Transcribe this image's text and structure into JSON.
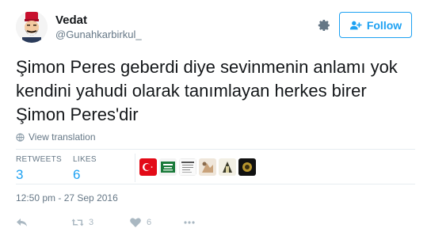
{
  "user": {
    "display_name": "Vedat",
    "handle": "@Gunahkarbirkul_"
  },
  "follow_button": {
    "label": "Follow"
  },
  "tweet": {
    "text": "Şimon Peres geberdi diye sevinmenin anlamı yok kendini yahudi olarak tanımlayan herkes birer Şimon Peres'dir",
    "translate_label": "View translation",
    "timestamp": "12:50 pm - 27 Sep 2016"
  },
  "stats": {
    "retweets_label": "RETWEETS",
    "retweets_value": "3",
    "likes_label": "LIKES",
    "likes_value": "6"
  },
  "actions": {
    "retweet_count": "3",
    "like_count": "6"
  },
  "colors": {
    "accent": "#1da1f2",
    "text": "#14171a",
    "muted": "#657786",
    "icon": "#aab8c2",
    "divider": "#e6ecf0"
  },
  "icons": {
    "settings": "gear-icon",
    "follow": "add-user-icon",
    "translate": "globe-icon",
    "reply": "reply-icon",
    "retweet": "retweet-icon",
    "like": "heart-icon",
    "more": "more-dots-icon"
  }
}
